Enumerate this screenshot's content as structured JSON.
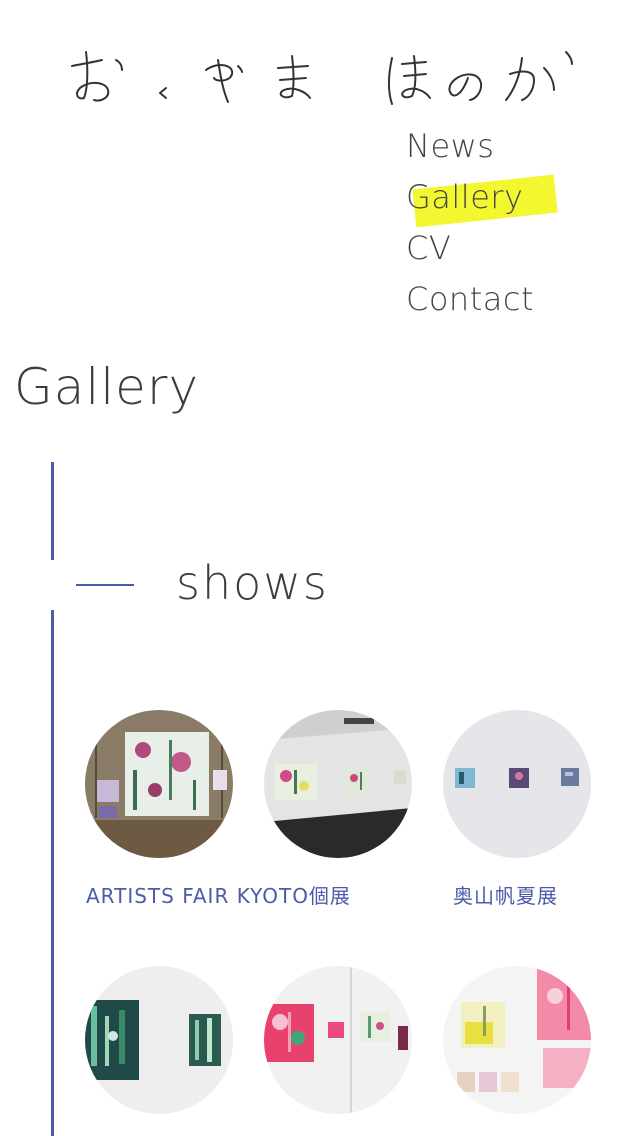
{
  "logo": {
    "text": "おくやま ほのか"
  },
  "nav": {
    "items": [
      {
        "label": "News"
      },
      {
        "label": "Gallery"
      },
      {
        "label": "CV"
      },
      {
        "label": "Contact"
      }
    ],
    "active_index": 1,
    "highlight_color": "#f2f72f"
  },
  "page": {
    "title": "Gallery"
  },
  "section": {
    "title": "shows"
  },
  "accent_color": "#4c5aa8",
  "gallery": {
    "items": [
      {
        "caption": "ARTISTS FAIR KYOTO個展"
      },
      {
        "caption": ""
      },
      {
        "caption": "奥山帆夏展"
      },
      {
        "caption": ""
      },
      {
        "caption": ""
      },
      {
        "caption": ""
      }
    ]
  }
}
